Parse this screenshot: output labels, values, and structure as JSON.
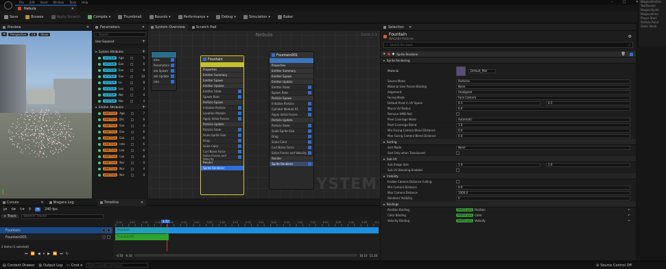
{
  "menu": {
    "items": [
      "File",
      "Edit",
      "Asset",
      "Window",
      "Tools",
      "Help"
    ]
  },
  "window": {
    "tab_title": "Nebula"
  },
  "toolbar": {
    "save": "Save",
    "browse": "Browse",
    "apply_scratch": "Apply Scratch",
    "compile": "Compile",
    "thumbnail": "Thumbnail",
    "bounds": "Bounds",
    "performance": "Performance",
    "debug": "Debug",
    "simulation": "Simulation",
    "baker": "Baker"
  },
  "preview": {
    "title": "Preview",
    "perspective": "Perspective",
    "lit": "Lit",
    "show": "Show"
  },
  "parameters": {
    "title": "Parameters",
    "search_placeholder": "Search",
    "user_exposed": "User Exposed",
    "system_attributes": "System Attributes",
    "system_rows": [
      {
        "tag": "SYSTEM",
        "name": "Age",
        "val": "5"
      },
      {
        "tag": "SYSTEM",
        "name": "Exe",
        "val": "6"
      },
      {
        "tag": "SYSTEM",
        "name": "Exe",
        "val": "9"
      },
      {
        "tag": "SYSTEM",
        "name": "Exe",
        "val": "10"
      },
      {
        "tag": "SYSTEM",
        "name": "Lo",
        "val": "8"
      },
      {
        "tag": "SYSTEM",
        "name": "Loo",
        "val": "3"
      },
      {
        "tag": "SYSTEM",
        "name": "Nor",
        "val": "4"
      },
      {
        "tag": "SYSTEM",
        "name": "Nor",
        "val": "4"
      }
    ],
    "emitter_attributes": "Emitter Attributes",
    "emitter_rows": [
      {
        "tag": "EMITTER",
        "name": "Age",
        "val": "7"
      },
      {
        "tag": "EMITTER",
        "name": "Dis",
        "val": "6"
      },
      {
        "tag": "EMITTER",
        "name": "Exe",
        "val": "4"
      },
      {
        "tag": "EMITTER",
        "name": "Exe",
        "val": "6"
      },
      {
        "tag": "EMITTER",
        "name": "Exe",
        "val": "6"
      },
      {
        "tag": "EMITTER",
        "name": "Inte",
        "val": "6"
      },
      {
        "tag": "EMITTER",
        "name": "Loo",
        "val": "6"
      },
      {
        "tag": "EMITTER",
        "name": "Loo",
        "val": "8"
      },
      {
        "tag": "EMITTER",
        "name": "Nor",
        "val": "4"
      },
      {
        "tag": "EMITTER",
        "name": "Nor",
        "val": "4"
      },
      {
        "tag": "EMITTER",
        "name": "Nor",
        "val": "4"
      }
    ]
  },
  "graph": {
    "tabs": [
      "System Overview",
      "Scratch Pad"
    ],
    "system_name": "Nebula",
    "zoom": "Zoom 1:1",
    "watermark": "SYSTEM",
    "left_node_rows": [
      "ates",
      "Parameters",
      "ate Spawn",
      "ate Update",
      "tate"
    ],
    "fountain": {
      "title": "Fountain",
      "rows": [
        "Properties",
        "Emitter Summary",
        "Emitter Spawn",
        "Emitter Update",
        "Emitter State",
        "Spawn Rate",
        "Particle Spawn",
        "Initialize Particle",
        "Location Module",
        "Apply Initial Forces",
        "Particle Update",
        "Particle State",
        "Scale Sprite Size",
        "Drag",
        "Scale Color",
        "Curl Noise Force",
        "Solve Forces and Velocity",
        "Render",
        "Sprite Renderer"
      ]
    },
    "fountain001": {
      "title": "Fountain001",
      "rows": [
        "Properties",
        "Emitter Summary",
        "Emitter Spawn",
        "Emitter Update",
        "Emitter State",
        "Spawn Rate",
        "Particle Spawn",
        "Initialize Particle",
        "Cylinder Module 01",
        "Apply Initial Forces",
        "Particle Update",
        "Particle State",
        "Scale Sprite Size",
        "Drag",
        "Scale Color",
        "Curl Noise Force",
        "Solve Forces and Velocity",
        "Render",
        "Sprite Renderer"
      ]
    },
    "usage": "Usage",
    "trace": "Trace",
    "infinite": "Infinite"
  },
  "selection": {
    "title": "Selection",
    "emitter_name": "Fountain",
    "emitter_sub": "NIAGARA Particles",
    "search_placeholder": "Search the stack",
    "renderer_label": "Sprite Renderer",
    "sprite_rendering": "Sprite Rendering",
    "material_label": "Material",
    "material_value": "Default_Mat",
    "rows": [
      {
        "label": "Source Mode",
        "value": "Particles"
      },
      {
        "label": "Material User Param Binding",
        "value": "None"
      },
      {
        "label": "Alignment",
        "value": "Unaligned"
      },
      {
        "label": "Facing Mode",
        "value": "Face Camera"
      },
      {
        "label": "Default Pivot in UV Space",
        "value": "0.5",
        "value2": "0.5"
      },
      {
        "label": "Macro UV Radius",
        "value": "0.0"
      },
      {
        "label": "Remove HMD Roll",
        "value": ""
      },
      {
        "label": "Pixel Coverage Mode",
        "value": "Automatic"
      },
      {
        "label": "Pixel Coverage Blend",
        "value": "1.0"
      },
      {
        "label": "Min Facing Camera Blend Distance",
        "value": "0.0"
      },
      {
        "label": "Max Facing Camera Blend Distance",
        "value": "0.0"
      }
    ],
    "sorting": "Sorting",
    "sorting_rows": [
      {
        "label": "Sort Mode",
        "value": "None"
      },
      {
        "label": "Sort Only when Translucent",
        "value": ""
      }
    ],
    "sub_uv": "Sub UV",
    "sub_uv_rows": [
      {
        "label": "Sub Image Size",
        "value": "1.0",
        "value2": "1.0"
      },
      {
        "label": "Sub UV Blending Enabled",
        "value": ""
      }
    ],
    "visibility": "Visibility",
    "visibility_rows": [
      {
        "label": "Enable Camera Distance Culling",
        "value": ""
      },
      {
        "label": "Min Camera Distance",
        "value": "0.0"
      },
      {
        "label": "Max Camera Distance",
        "value": "1000.0"
      },
      {
        "label": "Renderer Visibility",
        "value": "0"
      }
    ],
    "bindings": "Bindings",
    "binding_rows": [
      {
        "label": "Position Binding",
        "tag": "PARTICLES",
        "value": "Position"
      },
      {
        "label": "Color Binding",
        "tag": "PARTICLES",
        "value": "Color"
      },
      {
        "label": "Velocity Binding",
        "tag": "PARTICLES",
        "value": "Velocity"
      }
    ]
  },
  "right_list": [
    "NiagaraEmitter",
    "TestRender",
    "NiagaraSyste",
    "NiagaraActor",
    "Player Start",
    "Particle Rend",
    "Static Mesh"
  ],
  "bottom": {
    "curves": "Curves",
    "niagara_log": "Niagara Log",
    "timeline": "Timeline",
    "fps": "240 fps",
    "track": "+ Track",
    "search": "Search Tracks",
    "tracks": [
      "Fountain",
      "Fountain001"
    ],
    "playhead": "1.72",
    "ruler": [
      "0.00",
      "0.25",
      "0.50",
      "0.75",
      "1.00",
      "1.25",
      "1.50",
      "1.75",
      "2.00",
      "2.25",
      "2.50",
      "2.75",
      "3.00",
      "3.25",
      "3.50",
      "3.75",
      "4.00",
      "4.25",
      "4.50",
      "4.75",
      "5.00",
      "5.25",
      "5.50",
      "5.75",
      "6.00",
      "6.25",
      "6.50",
      "6.75",
      "7.00",
      "7.25",
      "7.50",
      "7.75",
      "8.00",
      "8.25",
      "8.50",
      "8.75",
      "9.00",
      "9.25",
      "9.50",
      "9.75",
      "10.00"
    ],
    "range_start": "-0.10",
    "range_start2": "-0.10",
    "range_end": "10.10",
    "range_end2": "11.10",
    "items_selected": "2 items (1 selected)"
  },
  "status": {
    "content_drawer": "Content Drawer",
    "output_log": "Output Log",
    "cmd": "Cmd",
    "console_placeholder": "Enter Console Command",
    "source_control": "Source Control Off"
  }
}
